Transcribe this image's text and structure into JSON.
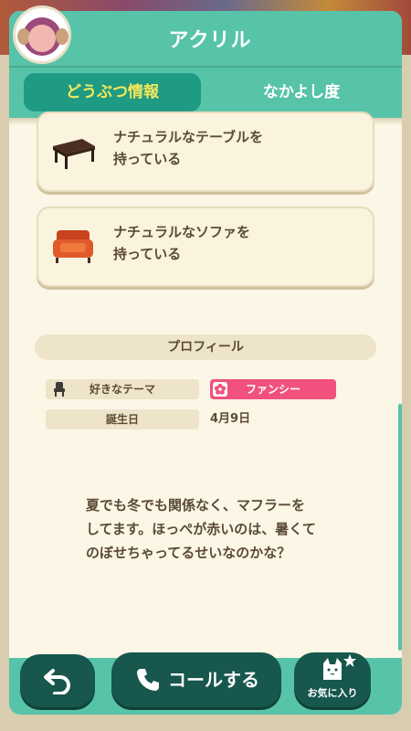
{
  "header": {
    "title": "アクリル",
    "tabs": [
      {
        "label": "どうぶつ情報",
        "active": true
      },
      {
        "label": "なかよし度",
        "active": false
      }
    ]
  },
  "items": [
    {
      "label_line1": "ナチュラルなテーブルを",
      "label_line2": "持っている",
      "icon": "table-icon"
    },
    {
      "label_line1": "ナチュラルなソファを",
      "label_line2": "持っている",
      "icon": "sofa-icon"
    }
  ],
  "profile": {
    "header": "プロフィール",
    "favorite_theme_label": "好きなテーマ",
    "favorite_theme_value": "ファンシー",
    "birthday_label": "誕生日",
    "birthday_value": "4月9日",
    "bio_line1": "夏でも冬でも関係なく、マフラーを",
    "bio_line2": "してます。ほっぺが赤いのは、暑くて",
    "bio_line3": "のぼせちゃってるせいなのかな？"
  },
  "bottom_bar": {
    "back_icon": "back-arrow-icon",
    "call_label": "コールする",
    "call_icon": "phone-icon",
    "favorite_label": "お気に入り",
    "favorite_icon": "cat-icon"
  },
  "colors": {
    "accent": "#57c3a9",
    "tab_active": "#1f9a83",
    "tab_active_text": "#f6e85a",
    "button": "#17574d",
    "theme_pill": "#f0517d",
    "text": "#5b4a36",
    "panel": "#fbf6e6"
  }
}
